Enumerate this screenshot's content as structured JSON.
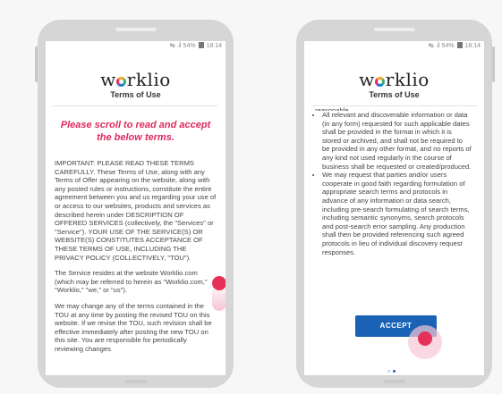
{
  "status_bar": {
    "signal": "↹ .il",
    "battery_percent": "54%",
    "time": "18:14"
  },
  "brand": {
    "logo_text_before": "w",
    "logo_text_after": "rklio",
    "subtitle": "Terms of Use"
  },
  "left_screen": {
    "scroll_prompt": "Please scroll to read and accept the below terms.",
    "paragraphs": [
      "IMPORTANT: PLEASE READ THESE TERMS CAREFULLY. These Terms of Use, along with any Terms of Offer appearing on the website, along with any posted rules or instructions, constitute the entire agreement between you and us regarding your use of or access to our websites, products and services as described herein under DESCRIPTION OF OFFERED SERVICES (collectively, the \"Services\" or \"Service\"). YOUR USE OF THE SERVICE(S) OR WEBSITE(S) CONSTITUTES ACCEPTANCE OF THESE TERMS OF USE, INCLUDING THE PRIVACY POLICY (COLLECTIVELY, \"TOU\").",
      "The Service resides at the website Worklio.com (which may be referred to herein as \"Worklio.com,\" \"Worklio,\" \"we,\" or \"us\").",
      "We may change any of the terms contained in the TOU at any time by posting the revised TOU on this website. If we revise the TOU, such revision shall be effective immediately after posting the new TOU on this site. You are responsible for periodically reviewing changes"
    ]
  },
  "right_screen": {
    "cut_line": "reasonable.",
    "bullets": [
      "All relevant and discoverable information or data (in any form) requested for such applicable dates shall be provided in the format in which it is stored or archived, and shall not be required to be provided in any other format, and no reports of any kind not used regularly in the course of business shall be requested or created/produced.",
      "We may request that parties and/or users cooperate in good faith regarding formulation of appropriate search terms and protocols in advance of any information or data search, including pre-search formulating of search terms, including semantic synonyms, search protocols and post-search error sampling. Any production shall then be provided referencing such agreed protocols in lieu of individual discovery request responses."
    ],
    "accept_label": "ACCEPT"
  },
  "colors": {
    "accent_red": "#e0285f",
    "button_blue": "#1a62b6"
  },
  "icons": {
    "signal": "signal-icon",
    "battery": "battery-icon",
    "logo_o": "worklio-logo-o-icon",
    "touch": "touch-indicator-icon"
  }
}
